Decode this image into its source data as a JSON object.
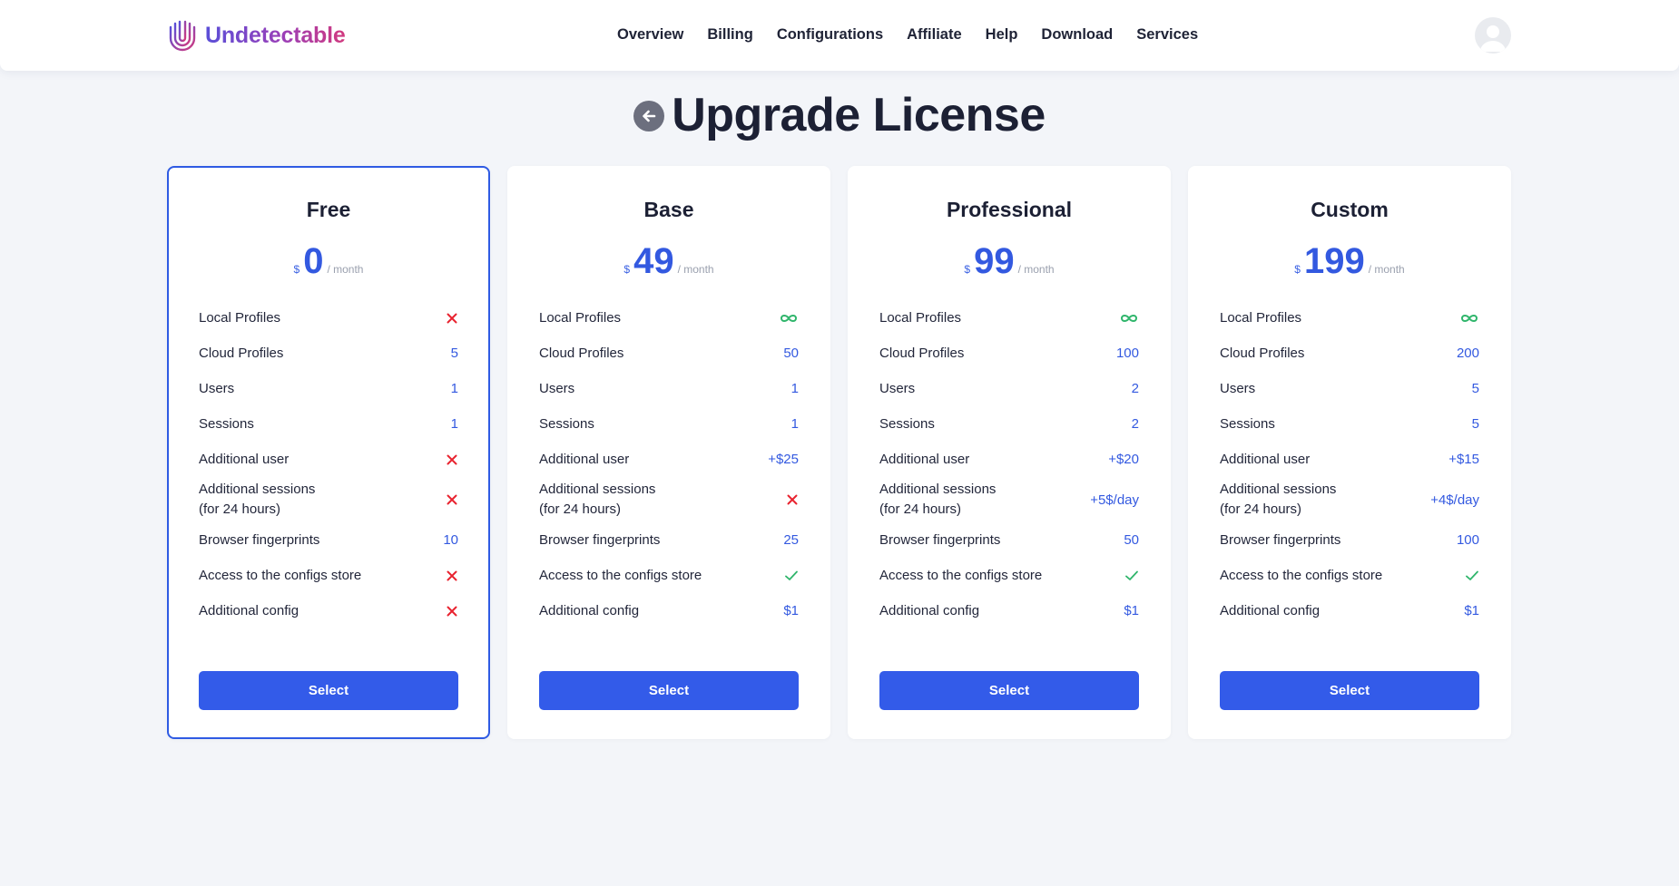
{
  "brand": {
    "name": "Undetectable",
    "gradient": [
      "#5a4fd8",
      "#9a3fb8",
      "#d23a7e"
    ]
  },
  "nav": [
    "Overview",
    "Billing",
    "Configurations",
    "Affiliate",
    "Help",
    "Download",
    "Services"
  ],
  "page": {
    "title": "Upgrade License"
  },
  "colors": {
    "accent": "#335be9",
    "value": "#3359e0",
    "cross": "#e8232f",
    "check": "#2fb56b",
    "infinity": "#2fb56b"
  },
  "price_unit": {
    "currency": "$",
    "period": "/ month"
  },
  "plans": [
    {
      "name": "Free",
      "price": "0",
      "selected": true,
      "button": "Select",
      "features": [
        {
          "label": "Local Profiles",
          "icon": "cross-icon"
        },
        {
          "label": "Cloud Profiles",
          "value": "5"
        },
        {
          "label": "Users",
          "value": "1"
        },
        {
          "label": "Sessions",
          "value": "1"
        },
        {
          "label": "Additional user",
          "icon": "cross-icon"
        },
        {
          "label": "Additional sessions\n(for 24 hours)",
          "icon": "cross-icon"
        },
        {
          "label": "Browser fingerprints",
          "value": "10"
        },
        {
          "label": "Access to the configs store",
          "icon": "cross-icon"
        },
        {
          "label": "Additional config",
          "icon": "cross-icon"
        }
      ]
    },
    {
      "name": "Base",
      "price": "49",
      "selected": false,
      "button": "Select",
      "features": [
        {
          "label": "Local Profiles",
          "icon": "infinity-icon"
        },
        {
          "label": "Cloud Profiles",
          "value": "50"
        },
        {
          "label": "Users",
          "value": "1"
        },
        {
          "label": "Sessions",
          "value": "1"
        },
        {
          "label": "Additional user",
          "value": "+$25"
        },
        {
          "label": "Additional sessions\n(for 24 hours)",
          "icon": "cross-icon"
        },
        {
          "label": "Browser fingerprints",
          "value": "25"
        },
        {
          "label": "Access to the configs store",
          "icon": "check-icon"
        },
        {
          "label": "Additional config",
          "value": "$1"
        }
      ]
    },
    {
      "name": "Professional",
      "price": "99",
      "selected": false,
      "button": "Select",
      "features": [
        {
          "label": "Local Profiles",
          "icon": "infinity-icon"
        },
        {
          "label": "Cloud Profiles",
          "value": "100"
        },
        {
          "label": "Users",
          "value": "2"
        },
        {
          "label": "Sessions",
          "value": "2"
        },
        {
          "label": "Additional user",
          "value": "+$20"
        },
        {
          "label": "Additional sessions\n(for 24 hours)",
          "value": "+5$/day"
        },
        {
          "label": "Browser fingerprints",
          "value": "50"
        },
        {
          "label": "Access to the configs store",
          "icon": "check-icon"
        },
        {
          "label": "Additional config",
          "value": "$1"
        }
      ]
    },
    {
      "name": "Custom",
      "price": "199",
      "selected": false,
      "button": "Select",
      "features": [
        {
          "label": "Local Profiles",
          "icon": "infinity-icon"
        },
        {
          "label": "Cloud Profiles",
          "value": "200"
        },
        {
          "label": "Users",
          "value": "5"
        },
        {
          "label": "Sessions",
          "value": "5"
        },
        {
          "label": "Additional user",
          "value": "+$15"
        },
        {
          "label": "Additional sessions\n(for 24 hours)",
          "value": "+4$/day"
        },
        {
          "label": "Browser fingerprints",
          "value": "100"
        },
        {
          "label": "Access to the configs store",
          "icon": "check-icon"
        },
        {
          "label": "Additional config",
          "value": "$1"
        }
      ]
    }
  ]
}
